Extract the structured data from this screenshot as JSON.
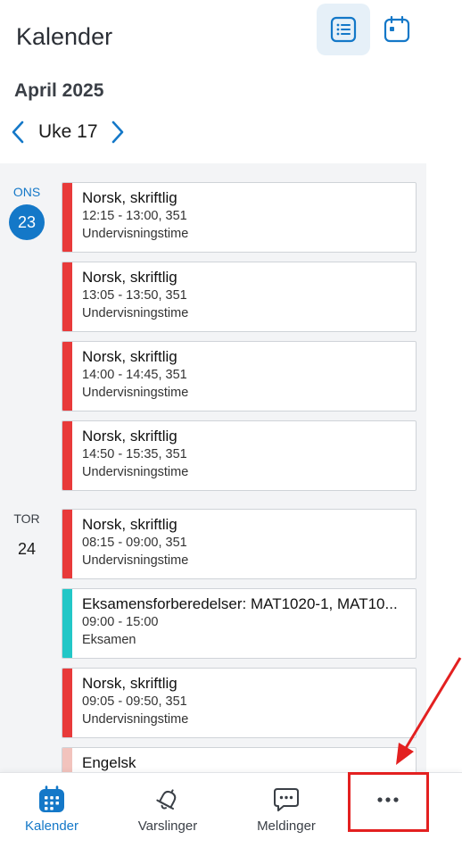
{
  "header": {
    "title": "Kalender",
    "month": "April 2025",
    "week": "Uke 17"
  },
  "days": [
    {
      "abbr": "ONS",
      "num": "23",
      "today": true,
      "events": [
        {
          "title": "Norsk, skriftlig",
          "time": "12:15 - 13:00, 351",
          "type": "Undervisningstime",
          "color": "#e83a3a"
        },
        {
          "title": "Norsk, skriftlig",
          "time": "13:05 - 13:50, 351",
          "type": "Undervisningstime",
          "color": "#e83a3a"
        },
        {
          "title": "Norsk, skriftlig",
          "time": "14:00 - 14:45, 351",
          "type": "Undervisningstime",
          "color": "#e83a3a"
        },
        {
          "title": "Norsk, skriftlig",
          "time": "14:50 - 15:35, 351",
          "type": "Undervisningstime",
          "color": "#e83a3a"
        }
      ]
    },
    {
      "abbr": "TOR",
      "num": "24",
      "today": false,
      "events": [
        {
          "title": "Norsk, skriftlig",
          "time": "08:15 - 09:00, 351",
          "type": "Undervisningstime",
          "color": "#e83a3a"
        },
        {
          "title": "Eksamensforberedelser: MAT1020-1, MAT10...",
          "time": "09:00 - 15:00",
          "type": "Eksamen",
          "color": "#22c7c7"
        },
        {
          "title": "Norsk, skriftlig",
          "time": "09:05 - 09:50, 351",
          "type": "Undervisningstime",
          "color": "#e83a3a"
        },
        {
          "title": "Engelsk",
          "time": "",
          "type": "",
          "color": "#f2c3bd"
        }
      ]
    }
  ],
  "tabs": [
    {
      "label": "Kalender",
      "icon": "calendar-icon",
      "active": true
    },
    {
      "label": "Varslinger",
      "icon": "bell-icon",
      "active": false
    },
    {
      "label": "Meldinger",
      "icon": "chat-icon",
      "active": false
    },
    {
      "label": "",
      "icon": "more-icon",
      "active": false
    }
  ],
  "colors": {
    "accent": "#1478c8",
    "lesson": "#e83a3a",
    "exam": "#22c7c7",
    "annotation": "#e32020"
  }
}
